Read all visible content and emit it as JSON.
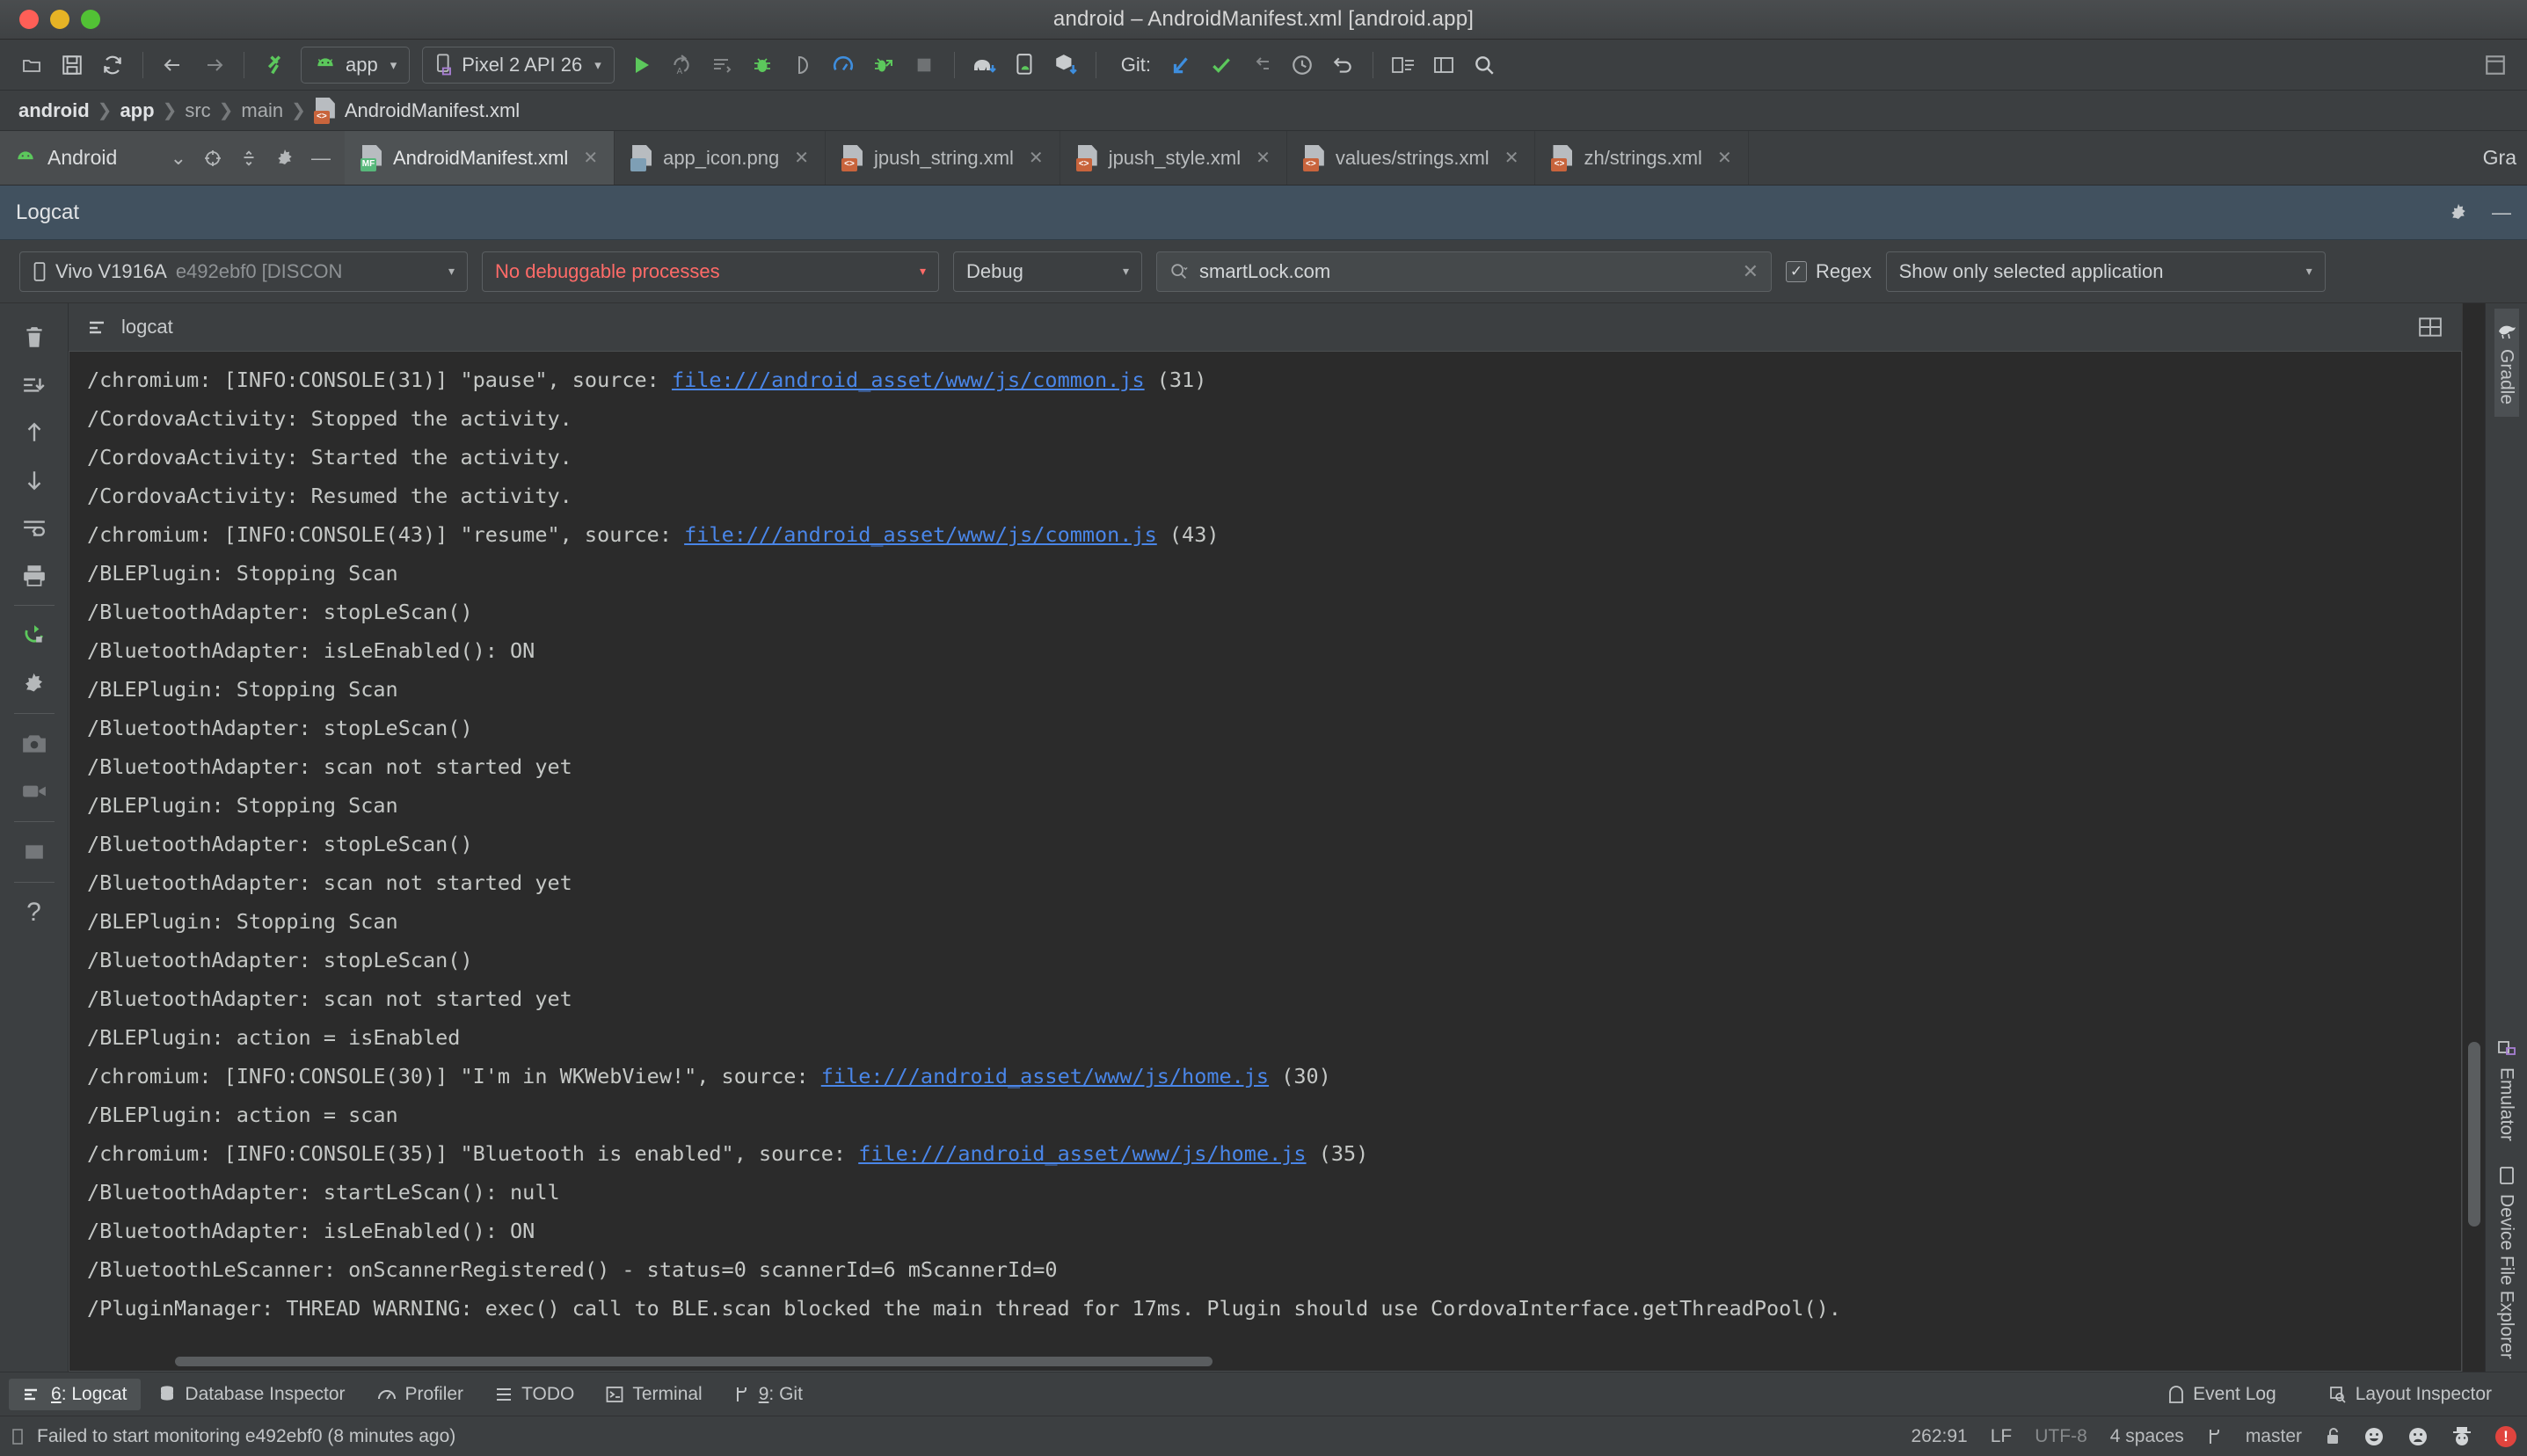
{
  "window": {
    "title": "android – AndroidManifest.xml [android.app]",
    "traffic_lights": [
      "close",
      "minimize",
      "zoom"
    ]
  },
  "toolbar": {
    "icons_left": [
      "open-icon",
      "save-icon",
      "sync-icon"
    ],
    "nav_icons": [
      "back-arrow-icon",
      "forward-arrow-icon"
    ],
    "build_icon": "hammer-icon",
    "run_config": {
      "label": "app",
      "icon": "android-icon",
      "caret": "▾"
    },
    "device_target": {
      "label": "Pixel 2 API 26",
      "icon": "device-icon",
      "caret": "▾"
    },
    "action_icons": [
      "run-icon",
      "apply-changes-icon",
      "apply-code-changes-icon",
      "debug-icon",
      "attach-debugger-icon",
      "profiler-icon",
      "debug-attach-icon",
      "stop-icon"
    ],
    "sdk_icons": [
      "avd-manager-icon",
      "sdk-manager-icon",
      "device-manager-icon"
    ],
    "git_label": "Git:",
    "git_icons": [
      "update-project-icon",
      "commit-icon",
      "push-icon",
      "history-icon",
      "undo-icon"
    ],
    "end_icons": [
      "project-structure-icon",
      "layout-editor-icon",
      "search-everywhere-icon"
    ],
    "far_right_icon": "maximize-icon"
  },
  "breadcrumb": {
    "items": [
      {
        "label": "android",
        "bold": true
      },
      {
        "label": "app",
        "bold": true
      },
      {
        "label": "src",
        "bold": false
      },
      {
        "label": "main",
        "bold": false
      },
      {
        "label": "AndroidManifest.xml",
        "bold": false,
        "icon": "xml-file-icon"
      }
    ],
    "separator": "❯"
  },
  "project_pane": {
    "title": "Android",
    "icon": "android-icon",
    "controls": [
      "chevron-down-icon",
      "target-icon",
      "collapse-all-icon",
      "settings-gear-icon",
      "hide-icon"
    ]
  },
  "file_tabs": [
    {
      "label": "AndroidManifest.xml",
      "badge": "MF",
      "badge_kind": "mf",
      "active": true
    },
    {
      "label": "app_icon.png",
      "badge": "",
      "badge_kind": "png",
      "active": false
    },
    {
      "label": "jpush_string.xml",
      "badge": "<>",
      "badge_kind": "xml",
      "active": false
    },
    {
      "label": "jpush_style.xml",
      "badge": "<>",
      "badge_kind": "xml",
      "active": false
    },
    {
      "label": "values/strings.xml",
      "badge": "<>",
      "badge_kind": "xml",
      "active": false
    },
    {
      "label": "zh/strings.xml",
      "badge": "<>",
      "badge_kind": "xml",
      "active": false
    }
  ],
  "gradle_stub_label": "Gra",
  "logcat_panel": {
    "title": "Logcat",
    "header_controls": [
      "settings-gear-icon",
      "minimize-icon"
    ],
    "subtab_label": "logcat",
    "subtab_icon": "logcat-icon",
    "grid_icon": "toggle-view-icon",
    "filters": {
      "device": {
        "name": "Vivo V1916A",
        "id": "e492ebf0 [DISCON",
        "icon": "device-icon",
        "caret": "▾"
      },
      "process": {
        "label": "No debuggable processes",
        "caret": "▾",
        "color": "#ff6b68"
      },
      "level": {
        "label": "Debug",
        "caret": "▾"
      },
      "search": {
        "value": "smartLock.com",
        "icon": "search-icon",
        "clear": "✕"
      },
      "regex": {
        "label": "Regex",
        "checked": true,
        "check_glyph": "✓"
      },
      "scope": {
        "label": "Show only selected application",
        "caret": "▾"
      }
    },
    "rail_icons": [
      "clear-logcat-icon",
      "scroll-to-end-icon",
      "up-arrow-icon",
      "down-arrow-icon",
      "soft-wrap-icon",
      "print-icon",
      "restart-icon",
      "settings-gear-icon",
      "screenshot-icon",
      "record-video-icon",
      "stop-icon",
      "help-icon"
    ],
    "log_lines": [
      {
        "text": "/chromium: [INFO:CONSOLE(31)] \"pause\", source: ",
        "link": "file:///android_asset/www/js/common.js",
        "tail": " (31)"
      },
      {
        "text": "/CordovaActivity: Stopped the activity.",
        "link": "",
        "tail": ""
      },
      {
        "text": "/CordovaActivity: Started the activity.",
        "link": "",
        "tail": ""
      },
      {
        "text": "/CordovaActivity: Resumed the activity.",
        "link": "",
        "tail": ""
      },
      {
        "text": "/chromium: [INFO:CONSOLE(43)] \"resume\", source: ",
        "link": "file:///android_asset/www/js/common.js",
        "tail": " (43)"
      },
      {
        "text": "/BLEPlugin: Stopping Scan",
        "link": "",
        "tail": ""
      },
      {
        "text": "/BluetoothAdapter: stopLeScan()",
        "link": "",
        "tail": ""
      },
      {
        "text": "/BluetoothAdapter: isLeEnabled(): ON",
        "link": "",
        "tail": ""
      },
      {
        "text": "/BLEPlugin: Stopping Scan",
        "link": "",
        "tail": ""
      },
      {
        "text": "/BluetoothAdapter: stopLeScan()",
        "link": "",
        "tail": ""
      },
      {
        "text": "/BluetoothAdapter: scan not started yet",
        "link": "",
        "tail": ""
      },
      {
        "text": "/BLEPlugin: Stopping Scan",
        "link": "",
        "tail": ""
      },
      {
        "text": "/BluetoothAdapter: stopLeScan()",
        "link": "",
        "tail": ""
      },
      {
        "text": "/BluetoothAdapter: scan not started yet",
        "link": "",
        "tail": ""
      },
      {
        "text": "/BLEPlugin: Stopping Scan",
        "link": "",
        "tail": ""
      },
      {
        "text": "/BluetoothAdapter: stopLeScan()",
        "link": "",
        "tail": ""
      },
      {
        "text": "/BluetoothAdapter: scan not started yet",
        "link": "",
        "tail": ""
      },
      {
        "text": "/BLEPlugin: action = isEnabled",
        "link": "",
        "tail": ""
      },
      {
        "text": "/chromium: [INFO:CONSOLE(30)] \"I'm in WKWebView!\", source: ",
        "link": "file:///android_asset/www/js/home.js",
        "tail": " (30)"
      },
      {
        "text": "/BLEPlugin: action = scan",
        "link": "",
        "tail": ""
      },
      {
        "text": "/chromium: [INFO:CONSOLE(35)] \"Bluetooth is enabled\", source: ",
        "link": "file:///android_asset/www/js/home.js",
        "tail": " (35)"
      },
      {
        "text": "/BluetoothAdapter: startLeScan(): null",
        "link": "",
        "tail": ""
      },
      {
        "text": "/BluetoothAdapter: isLeEnabled(): ON",
        "link": "",
        "tail": ""
      },
      {
        "text": "/BluetoothLeScanner: onScannerRegistered() - status=0 scannerId=6 mScannerId=0",
        "link": "",
        "tail": ""
      },
      {
        "text": "/PluginManager: THREAD WARNING: exec() call to BLE.scan blocked the main thread for 17ms. Plugin should use CordovaInterface.getThreadPool().",
        "link": "",
        "tail": ""
      }
    ]
  },
  "right_rail": [
    {
      "label": "Gradle",
      "icon": "gradle-elephant-icon",
      "selected": true
    },
    {
      "label": "Emulator",
      "icon": "emulator-icon",
      "selected": false
    },
    {
      "label": "Device File Explorer",
      "icon": "device-file-icon",
      "selected": false
    }
  ],
  "bottom_bar": {
    "tabs": [
      {
        "num": "6",
        "label": ": Logcat",
        "icon": "logcat-icon",
        "selected": true
      },
      {
        "num": "",
        "label": "Database Inspector",
        "icon": "database-icon",
        "selected": false
      },
      {
        "num": "",
        "label": "Profiler",
        "icon": "profiler-icon",
        "selected": false
      },
      {
        "num": "",
        "label": "TODO",
        "icon": "todo-icon",
        "selected": false
      },
      {
        "num": "",
        "label": "Terminal",
        "icon": "terminal-icon",
        "selected": false
      },
      {
        "num": "9",
        "label": ": Git",
        "icon": "git-branch-icon",
        "selected": false
      }
    ],
    "right_items": [
      {
        "label": "Event Log",
        "icon": "event-log-icon"
      },
      {
        "label": "Layout Inspector",
        "icon": "layout-inspector-icon"
      }
    ]
  },
  "status_bar": {
    "message": "Failed to start monitoring e492ebf0 (8 minutes ago)",
    "message_icon": "info-icon",
    "caret_position": "262:91",
    "line_separator": "LF",
    "encoding": "UTF-8",
    "indent": "4 spaces",
    "branch": "master",
    "branch_icon": "git-branch-icon",
    "lock_icon": "unlocked-icon",
    "face_icons": [
      "smiley-happy-icon",
      "smiley-sad-icon",
      "hat-guy-icon"
    ],
    "error_badge": "!"
  }
}
